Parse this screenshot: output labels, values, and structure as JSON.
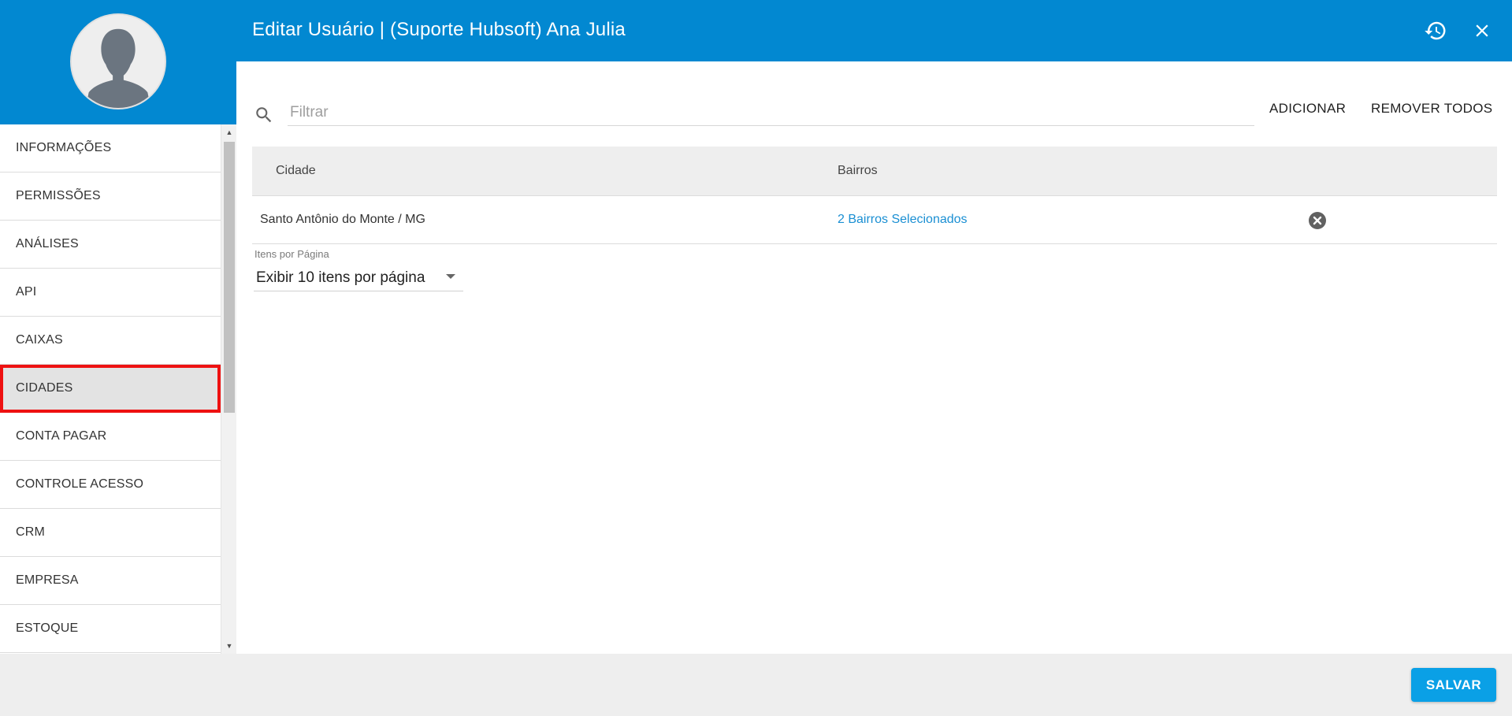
{
  "header": {
    "title": "Editar Usuário | (Suporte Hubsoft) Ana Julia",
    "history_icon": "history-icon",
    "close_icon": "close-icon"
  },
  "sidebar": {
    "items": [
      {
        "label": "INFORMAÇÕES",
        "active": false
      },
      {
        "label": "PERMISSÕES",
        "active": false
      },
      {
        "label": "ANÁLISES",
        "active": false
      },
      {
        "label": "API",
        "active": false
      },
      {
        "label": "CAIXAS",
        "active": false
      },
      {
        "label": "CIDADES",
        "active": true
      },
      {
        "label": "CONTA PAGAR",
        "active": false
      },
      {
        "label": "CONTROLE ACESSO",
        "active": false
      },
      {
        "label": "CRM",
        "active": false
      },
      {
        "label": "EMPRESA",
        "active": false
      },
      {
        "label": "ESTOQUE",
        "active": false
      }
    ]
  },
  "toolbar": {
    "filter_placeholder": "Filtrar",
    "filter_value": "",
    "add_label": "ADICIONAR",
    "remove_all_label": "REMOVER TODOS"
  },
  "table": {
    "columns": [
      "Cidade",
      "Bairros"
    ],
    "rows": [
      {
        "cidade": "Santo Antônio do Monte / MG",
        "bairros": "2 Bairros Selecionados"
      }
    ]
  },
  "pagination": {
    "label": "Itens por Página",
    "selected": "Exibir 10 itens por página"
  },
  "footer": {
    "save_label": "SALVAR"
  },
  "colors": {
    "primary": "#0288d1",
    "link": "#1a8fd3",
    "save_button": "#0aa0e6",
    "active_highlight": "#ee1111"
  }
}
